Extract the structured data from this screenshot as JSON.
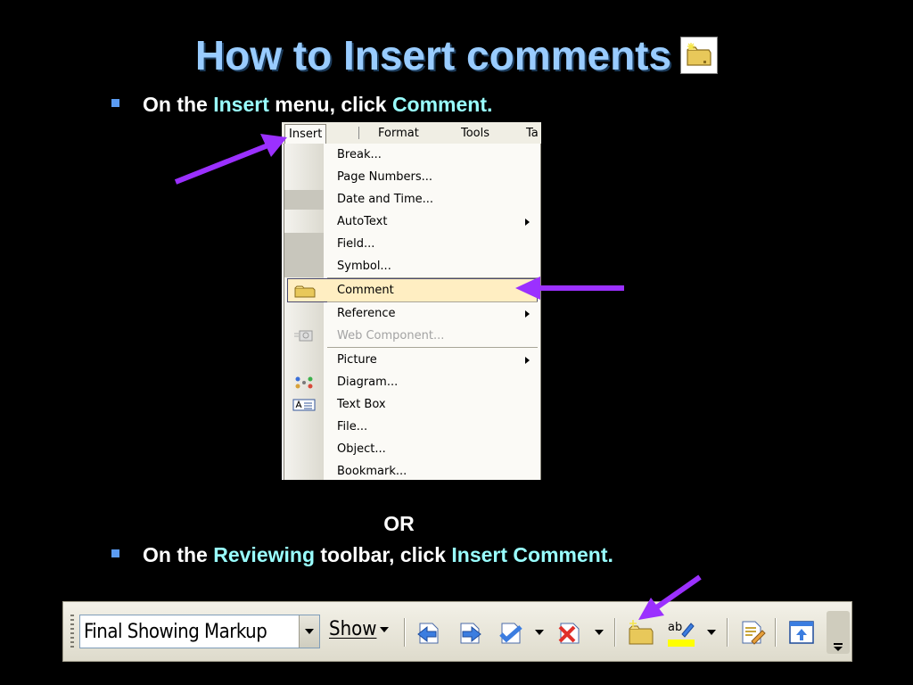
{
  "title": "How to Insert comments",
  "bullet1": {
    "prefix": "On the ",
    "menu": "Insert",
    "middle": " menu, click ",
    "item": "Comment."
  },
  "or": "OR",
  "bullet2": {
    "prefix": "On the ",
    "toolbar": "Reviewing",
    "middle": " toolbar, click ",
    "item": "Insert Comment."
  },
  "menubar": {
    "items": [
      "Insert",
      "Format",
      "Tools",
      "Ta"
    ]
  },
  "insert_menu": {
    "items": [
      {
        "label": "Break..."
      },
      {
        "label": "Page Numbers..."
      },
      {
        "label": "Date and Time..."
      },
      {
        "label": "AutoText",
        "submenu": true
      },
      {
        "label": "Field..."
      },
      {
        "label": "Symbol..."
      },
      {
        "label": "Comment",
        "highlighted": true,
        "icon": "comment-icon"
      },
      {
        "label": "Reference",
        "submenu": true
      },
      {
        "label": "Web Component...",
        "disabled": true,
        "icon": "web-component-icon"
      },
      {
        "label": "Picture",
        "submenu": true
      },
      {
        "label": "Diagram...",
        "icon": "diagram-icon"
      },
      {
        "label": "Text Box",
        "icon": "text-box-icon"
      },
      {
        "label": "File..."
      },
      {
        "label": "Object..."
      },
      {
        "label": "Bookmark..."
      }
    ]
  },
  "reviewing_toolbar": {
    "display_mode": "Final Showing Markup",
    "show_label": "Show",
    "buttons": [
      "previous-icon",
      "next-icon",
      "accept-change-icon",
      "reject-change-icon",
      "insert-comment-icon",
      "highlight-icon",
      "track-changes-icon",
      "reviewing-pane-icon"
    ]
  },
  "colors": {
    "title": "#99ccff",
    "highlight_text": "#99ffff",
    "bullet": "#5b9cf3",
    "arrow": "#9b30ff",
    "menu_highlight": "#ffeec2"
  }
}
